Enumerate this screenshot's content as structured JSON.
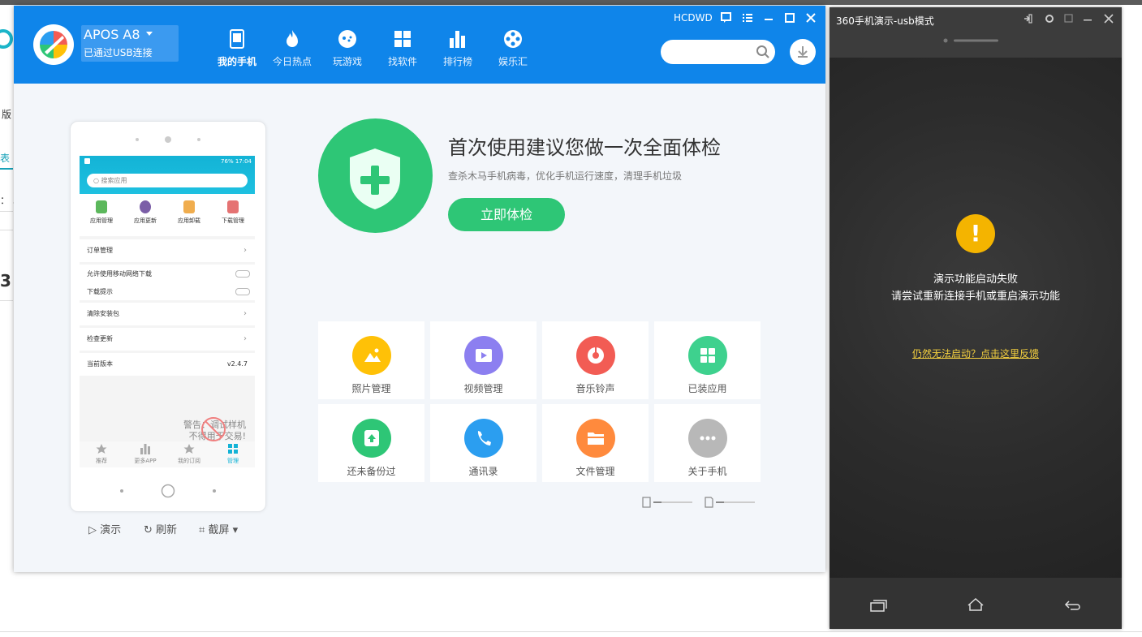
{
  "background_app": {
    "label_a": "版",
    "label_b": "表",
    "label_c": "： 3",
    "label_d": "3"
  },
  "header": {
    "device_name": "APOS A8",
    "device_status": "已通过USB连接",
    "user": "HCDWD",
    "nav": [
      {
        "label": "我的手机",
        "icon": "phone-icon"
      },
      {
        "label": "今日热点",
        "icon": "fire-icon"
      },
      {
        "label": "玩游戏",
        "icon": "game-icon"
      },
      {
        "label": "找软件",
        "icon": "apps-icon"
      },
      {
        "label": "排行榜",
        "icon": "chart-icon"
      },
      {
        "label": "娱乐汇",
        "icon": "film-reel-icon"
      }
    ],
    "search": {
      "placeholder": ""
    }
  },
  "phone": {
    "status_bar": "76% 17:04",
    "search_placeholder": "搜索应用",
    "quick_icons": [
      {
        "label": "应用管理",
        "color": "#5cb85c"
      },
      {
        "label": "应用更新",
        "color": "#7b5ea7"
      },
      {
        "label": "应用卸载",
        "color": "#f0ad4e"
      },
      {
        "label": "下载管理",
        "color": "#e57373"
      }
    ],
    "rows": {
      "orders": "订单管理",
      "mobile_download": "允许使用移动网络下载",
      "download_tip": "下载提示",
      "clear_packages": "清除安装包",
      "check_update": "检查更新",
      "version_label": "当前版本",
      "version_value": "v2.4.7"
    },
    "warning_line1": "警告：调试样机",
    "warning_line2": "不得用于交易!",
    "tabs": [
      {
        "label": "推荐"
      },
      {
        "label": "更多APP"
      },
      {
        "label": "我的订阅"
      },
      {
        "label": "管理"
      }
    ],
    "tools": {
      "demo": "演示",
      "refresh": "刷新",
      "screenshot": "截屏"
    }
  },
  "checkup": {
    "title": "首次使用建议您做一次全面体检",
    "subtitle": "查杀木马手机病毒，优化手机运行速度，清理手机垃圾",
    "button": "立即体检"
  },
  "tiles": [
    {
      "label": "照片管理",
      "color": "#ffc107",
      "icon": "photo-icon"
    },
    {
      "label": "视频管理",
      "color": "#8c7ff0",
      "icon": "video-icon"
    },
    {
      "label": "音乐铃声",
      "color": "#f25c54",
      "icon": "music-icon"
    },
    {
      "label": "已装应用",
      "color": "#3ed18e",
      "icon": "grid-icon"
    },
    {
      "label": "还未备份过",
      "color": "#2ec676",
      "icon": "backup-icon"
    },
    {
      "label": "通讯录",
      "color": "#2b9ef0",
      "icon": "phone-call-icon"
    },
    {
      "label": "文件管理",
      "color": "#ff8a3d",
      "icon": "folder-icon"
    },
    {
      "label": "关于手机",
      "color": "#b8b8b8",
      "icon": "more-icon"
    }
  ],
  "demo_panel": {
    "title": "360手机演示-usb模式",
    "message_line1": "演示功能启动失败",
    "message_line2": "请尝试重新连接手机或重启演示功能",
    "feedback_link": "仍然无法启动？点击这里反馈"
  }
}
